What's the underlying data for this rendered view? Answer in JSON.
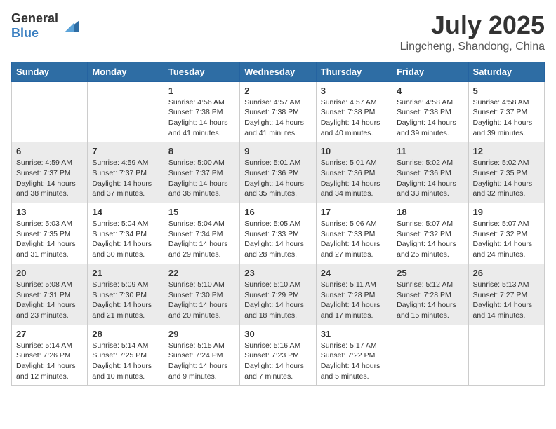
{
  "header": {
    "logo_general": "General",
    "logo_blue": "Blue",
    "month_year": "July 2025",
    "location": "Lingcheng, Shandong, China"
  },
  "weekdays": [
    "Sunday",
    "Monday",
    "Tuesday",
    "Wednesday",
    "Thursday",
    "Friday",
    "Saturday"
  ],
  "weeks": [
    [
      {
        "day": "",
        "sunrise": "",
        "sunset": "",
        "daylight": ""
      },
      {
        "day": "",
        "sunrise": "",
        "sunset": "",
        "daylight": ""
      },
      {
        "day": "1",
        "sunrise": "Sunrise: 4:56 AM",
        "sunset": "Sunset: 7:38 PM",
        "daylight": "Daylight: 14 hours and 41 minutes."
      },
      {
        "day": "2",
        "sunrise": "Sunrise: 4:57 AM",
        "sunset": "Sunset: 7:38 PM",
        "daylight": "Daylight: 14 hours and 41 minutes."
      },
      {
        "day": "3",
        "sunrise": "Sunrise: 4:57 AM",
        "sunset": "Sunset: 7:38 PM",
        "daylight": "Daylight: 14 hours and 40 minutes."
      },
      {
        "day": "4",
        "sunrise": "Sunrise: 4:58 AM",
        "sunset": "Sunset: 7:38 PM",
        "daylight": "Daylight: 14 hours and 39 minutes."
      },
      {
        "day": "5",
        "sunrise": "Sunrise: 4:58 AM",
        "sunset": "Sunset: 7:37 PM",
        "daylight": "Daylight: 14 hours and 39 minutes."
      }
    ],
    [
      {
        "day": "6",
        "sunrise": "Sunrise: 4:59 AM",
        "sunset": "Sunset: 7:37 PM",
        "daylight": "Daylight: 14 hours and 38 minutes."
      },
      {
        "day": "7",
        "sunrise": "Sunrise: 4:59 AM",
        "sunset": "Sunset: 7:37 PM",
        "daylight": "Daylight: 14 hours and 37 minutes."
      },
      {
        "day": "8",
        "sunrise": "Sunrise: 5:00 AM",
        "sunset": "Sunset: 7:37 PM",
        "daylight": "Daylight: 14 hours and 36 minutes."
      },
      {
        "day": "9",
        "sunrise": "Sunrise: 5:01 AM",
        "sunset": "Sunset: 7:36 PM",
        "daylight": "Daylight: 14 hours and 35 minutes."
      },
      {
        "day": "10",
        "sunrise": "Sunrise: 5:01 AM",
        "sunset": "Sunset: 7:36 PM",
        "daylight": "Daylight: 14 hours and 34 minutes."
      },
      {
        "day": "11",
        "sunrise": "Sunrise: 5:02 AM",
        "sunset": "Sunset: 7:36 PM",
        "daylight": "Daylight: 14 hours and 33 minutes."
      },
      {
        "day": "12",
        "sunrise": "Sunrise: 5:02 AM",
        "sunset": "Sunset: 7:35 PM",
        "daylight": "Daylight: 14 hours and 32 minutes."
      }
    ],
    [
      {
        "day": "13",
        "sunrise": "Sunrise: 5:03 AM",
        "sunset": "Sunset: 7:35 PM",
        "daylight": "Daylight: 14 hours and 31 minutes."
      },
      {
        "day": "14",
        "sunrise": "Sunrise: 5:04 AM",
        "sunset": "Sunset: 7:34 PM",
        "daylight": "Daylight: 14 hours and 30 minutes."
      },
      {
        "day": "15",
        "sunrise": "Sunrise: 5:04 AM",
        "sunset": "Sunset: 7:34 PM",
        "daylight": "Daylight: 14 hours and 29 minutes."
      },
      {
        "day": "16",
        "sunrise": "Sunrise: 5:05 AM",
        "sunset": "Sunset: 7:33 PM",
        "daylight": "Daylight: 14 hours and 28 minutes."
      },
      {
        "day": "17",
        "sunrise": "Sunrise: 5:06 AM",
        "sunset": "Sunset: 7:33 PM",
        "daylight": "Daylight: 14 hours and 27 minutes."
      },
      {
        "day": "18",
        "sunrise": "Sunrise: 5:07 AM",
        "sunset": "Sunset: 7:32 PM",
        "daylight": "Daylight: 14 hours and 25 minutes."
      },
      {
        "day": "19",
        "sunrise": "Sunrise: 5:07 AM",
        "sunset": "Sunset: 7:32 PM",
        "daylight": "Daylight: 14 hours and 24 minutes."
      }
    ],
    [
      {
        "day": "20",
        "sunrise": "Sunrise: 5:08 AM",
        "sunset": "Sunset: 7:31 PM",
        "daylight": "Daylight: 14 hours and 23 minutes."
      },
      {
        "day": "21",
        "sunrise": "Sunrise: 5:09 AM",
        "sunset": "Sunset: 7:30 PM",
        "daylight": "Daylight: 14 hours and 21 minutes."
      },
      {
        "day": "22",
        "sunrise": "Sunrise: 5:10 AM",
        "sunset": "Sunset: 7:30 PM",
        "daylight": "Daylight: 14 hours and 20 minutes."
      },
      {
        "day": "23",
        "sunrise": "Sunrise: 5:10 AM",
        "sunset": "Sunset: 7:29 PM",
        "daylight": "Daylight: 14 hours and 18 minutes."
      },
      {
        "day": "24",
        "sunrise": "Sunrise: 5:11 AM",
        "sunset": "Sunset: 7:28 PM",
        "daylight": "Daylight: 14 hours and 17 minutes."
      },
      {
        "day": "25",
        "sunrise": "Sunrise: 5:12 AM",
        "sunset": "Sunset: 7:28 PM",
        "daylight": "Daylight: 14 hours and 15 minutes."
      },
      {
        "day": "26",
        "sunrise": "Sunrise: 5:13 AM",
        "sunset": "Sunset: 7:27 PM",
        "daylight": "Daylight: 14 hours and 14 minutes."
      }
    ],
    [
      {
        "day": "27",
        "sunrise": "Sunrise: 5:14 AM",
        "sunset": "Sunset: 7:26 PM",
        "daylight": "Daylight: 14 hours and 12 minutes."
      },
      {
        "day": "28",
        "sunrise": "Sunrise: 5:14 AM",
        "sunset": "Sunset: 7:25 PM",
        "daylight": "Daylight: 14 hours and 10 minutes."
      },
      {
        "day": "29",
        "sunrise": "Sunrise: 5:15 AM",
        "sunset": "Sunset: 7:24 PM",
        "daylight": "Daylight: 14 hours and 9 minutes."
      },
      {
        "day": "30",
        "sunrise": "Sunrise: 5:16 AM",
        "sunset": "Sunset: 7:23 PM",
        "daylight": "Daylight: 14 hours and 7 minutes."
      },
      {
        "day": "31",
        "sunrise": "Sunrise: 5:17 AM",
        "sunset": "Sunset: 7:22 PM",
        "daylight": "Daylight: 14 hours and 5 minutes."
      },
      {
        "day": "",
        "sunrise": "",
        "sunset": "",
        "daylight": ""
      },
      {
        "day": "",
        "sunrise": "",
        "sunset": "",
        "daylight": ""
      }
    ]
  ]
}
